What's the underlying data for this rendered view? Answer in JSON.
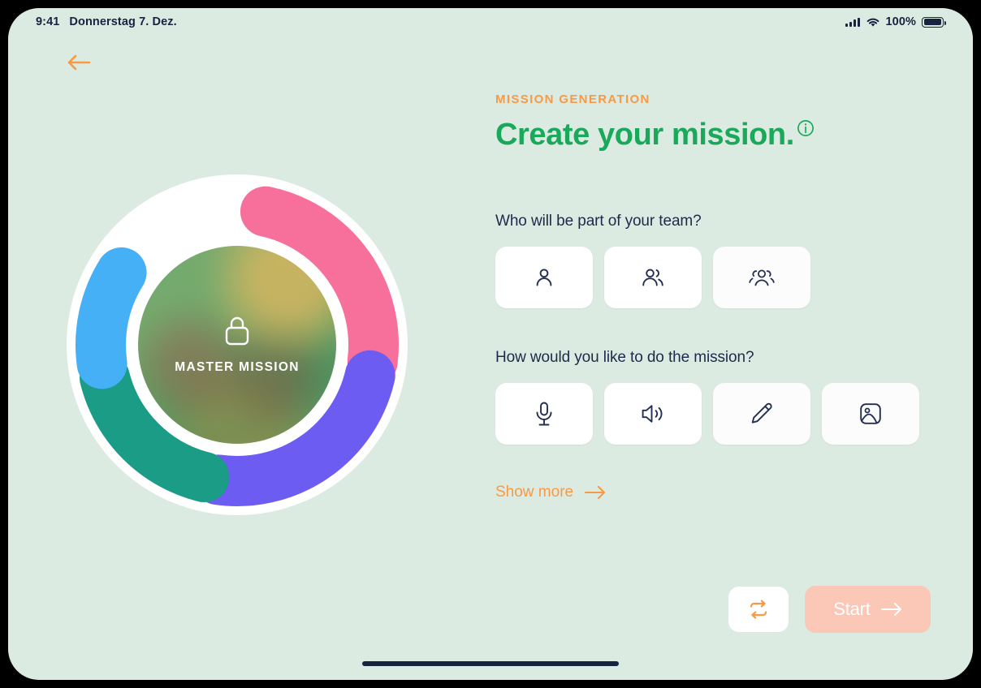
{
  "statusbar": {
    "time": "9:41",
    "date": "Donnerstag 7. Dez.",
    "battery_percent": "100%",
    "signal_icon": "signal-bars-icon",
    "wifi_icon": "wifi-icon",
    "battery_icon": "battery-full-icon"
  },
  "nav": {
    "back_icon": "arrow-left-icon"
  },
  "wheel": {
    "label": "MASTER MISSION",
    "lock_icon": "lock-icon",
    "segments": [
      {
        "name": "pink-segment",
        "color": "#f7709b",
        "start_deg": 12,
        "end_deg": 97
      },
      {
        "name": "purple-segment",
        "color": "#6c5cf2",
        "start_deg": 103,
        "end_deg": 188
      },
      {
        "name": "teal-segment",
        "color": "#1a9c87",
        "start_deg": 194,
        "end_deg": 256
      },
      {
        "name": "blue-segment",
        "color": "#45b0f6",
        "start_deg": 262,
        "end_deg": 302
      }
    ],
    "ring_color": "#ffffff"
  },
  "panel": {
    "eyebrow": "MISSION GENERATION",
    "title": "Create your mission.",
    "info_icon": "info-circle-icon",
    "questions": [
      {
        "label": "Who will be part of your team?",
        "options": [
          {
            "name": "team-option-solo",
            "icon": "person-icon"
          },
          {
            "name": "team-option-pair",
            "icon": "two-people-icon"
          },
          {
            "name": "team-option-group",
            "icon": "group-people-icon"
          }
        ]
      },
      {
        "label": "How would you like to do the mission?",
        "options": [
          {
            "name": "mode-option-voice",
            "icon": "microphone-icon"
          },
          {
            "name": "mode-option-audio",
            "icon": "speaker-icon"
          },
          {
            "name": "mode-option-write",
            "icon": "pencil-icon"
          },
          {
            "name": "mode-option-photo",
            "icon": "image-icon"
          }
        ]
      }
    ],
    "show_more": "Show more",
    "show_more_icon": "arrow-right-icon"
  },
  "footer": {
    "shuffle_icon": "shuffle-icon",
    "start_label": "Start",
    "start_icon": "arrow-right-icon"
  },
  "colors": {
    "background": "#dcebe2",
    "accent_orange": "#f79a45",
    "accent_green": "#1aa85a",
    "ink": "#1d2a4a",
    "start_button": "#fbc7b6"
  }
}
